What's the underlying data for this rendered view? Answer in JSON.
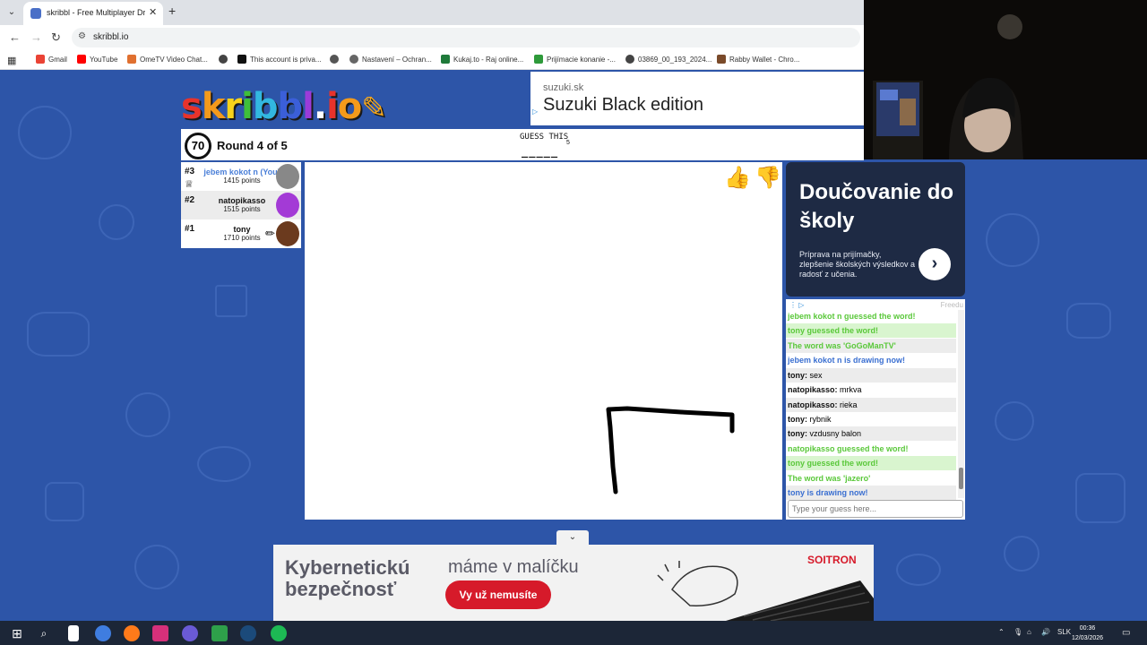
{
  "browser": {
    "tab_title": "skribbl - Free Multiplayer Drawi",
    "tab_close": "✕",
    "new_tab": "+",
    "url": "skribbl.io",
    "bookmarks": [
      {
        "label": "Gmail",
        "color": "#ea4335"
      },
      {
        "label": "YouTube",
        "color": "#ff0000"
      },
      {
        "label": "OmeTV Video Chat...",
        "color": "#e07030"
      },
      {
        "label": "",
        "color": "#444444"
      },
      {
        "label": "This account is priva...",
        "color": "#111111"
      },
      {
        "label": "",
        "color": "#555555"
      },
      {
        "label": "Nastavení – Ochran...",
        "color": "#666666"
      },
      {
        "label": "Kukaj.to - Raj online...",
        "color": "#1f7a3a"
      },
      {
        "label": "Prijímacie konanie -...",
        "color": "#2e9a3a"
      },
      {
        "label": "03869_00_193_2024...",
        "color": "#444444"
      },
      {
        "label": "Rabby Wallet - Chro...",
        "color": "#7a4a2a"
      }
    ]
  },
  "logo_letters": [
    {
      "ch": "s",
      "color": "#e8332b"
    },
    {
      "ch": "k",
      "color": "#f39a1b"
    },
    {
      "ch": "r",
      "color": "#f7d21a"
    },
    {
      "ch": "i",
      "color": "#3fbf3a"
    },
    {
      "ch": "b",
      "color": "#32b8e0"
    },
    {
      "ch": "b",
      "color": "#3b5fd9"
    },
    {
      "ch": "l",
      "color": "#9b3bd9"
    },
    {
      "ch": ".",
      "color": "#ffffff"
    },
    {
      "ch": "i",
      "color": "#e8332b"
    },
    {
      "ch": "o",
      "color": "#f39a1b"
    }
  ],
  "ads": {
    "top": {
      "domain": "suzuki.sk",
      "headline": "Suzuki Black edition"
    },
    "right": {
      "headline": "Doučovanie do školy",
      "body": "Príprava na prijímačky, zlepšenie školských výsledkov a radosť z učenia.",
      "go": "›"
    },
    "bottom": {
      "headline_1": "Kybernetickú",
      "headline_2": "bezpečnosť",
      "tagline": "máme v malíčku",
      "button": "Vy už nemusíte",
      "brand": "SOITRON"
    }
  },
  "game": {
    "timer": "70",
    "round": "Round 4 of 5",
    "guess_label": "GUESS THIS",
    "letter_count": "5",
    "word_blanks": "_____"
  },
  "players": [
    {
      "rank": "#3",
      "name": "jebem kokot n (You)",
      "points": "1415 points",
      "color": "#888888",
      "is_you": true
    },
    {
      "rank": "#2",
      "name": "natopikasso",
      "points": "1515 points",
      "color": "#a33ad6",
      "is_you": false
    },
    {
      "rank": "#1",
      "name": "tony",
      "points": "1710 points",
      "color": "#6b3a1e",
      "is_you": false
    }
  ],
  "chat": {
    "freedom_label": "Freedu",
    "messages": [
      {
        "type": "green",
        "text": "jebem kokot n guessed the word!"
      },
      {
        "type": "greenbg",
        "text": "tony guessed the word!"
      },
      {
        "type": "green",
        "text": "The word was 'GoGoManTV'"
      },
      {
        "type": "blue",
        "text": "jebem kokot n is drawing now!"
      },
      {
        "type": "grey",
        "name": "tony:",
        "text": "sex"
      },
      {
        "type": "plain",
        "name": "natopikasso:",
        "text": "mrkva"
      },
      {
        "type": "grey",
        "name": "natopikasso:",
        "text": "rieka"
      },
      {
        "type": "plain",
        "name": "tony:",
        "text": "rybnik"
      },
      {
        "type": "grey",
        "name": "tony:",
        "text": "vzdusny balon"
      },
      {
        "type": "green",
        "text": "natopikasso guessed the word!"
      },
      {
        "type": "greenbg",
        "text": "tony guessed the word!"
      },
      {
        "type": "green",
        "text": "The word was 'jazero'"
      },
      {
        "type": "blue",
        "text": "tony is drawing now!"
      }
    ],
    "input_placeholder": "Type your guess here..."
  },
  "taskbar": {
    "lang": "SLK",
    "time": "00:36",
    "date": "12/03/2026"
  }
}
